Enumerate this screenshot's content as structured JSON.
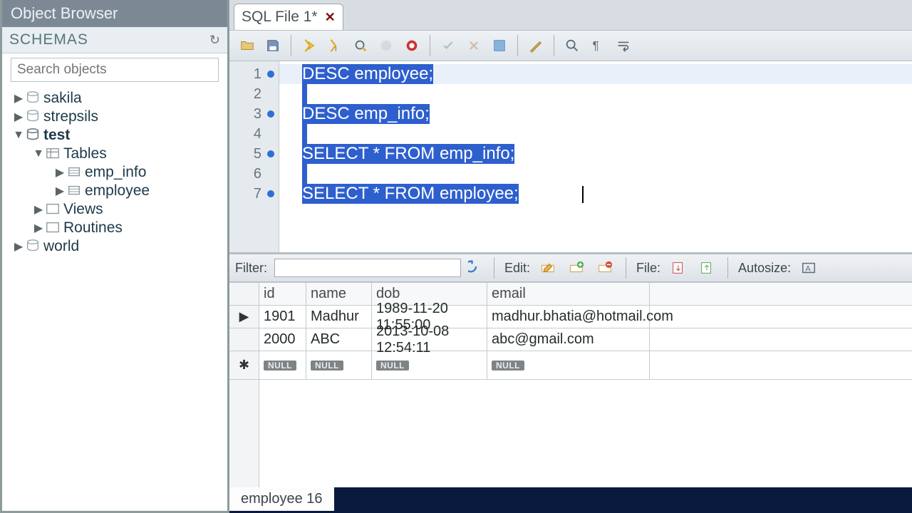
{
  "object_browser": {
    "title": "Object Browser",
    "schemas_label": "SCHEMAS",
    "search_placeholder": "Search objects",
    "tree": {
      "sakila": "sakila",
      "strepsils": "strepsils",
      "test": "test",
      "tables": "Tables",
      "emp_info": "emp_info",
      "employee": "employee",
      "views": "Views",
      "routines": "Routines",
      "world": "world"
    }
  },
  "tab": {
    "label": "SQL File 1*"
  },
  "editor": {
    "lines": {
      "1": {
        "kw": "DESC",
        "rest": " employee;"
      },
      "2": {
        "kw": "",
        "rest": ""
      },
      "3": {
        "kw": "DESC",
        "rest": " emp_info;"
      },
      "4": {
        "kw": "",
        "rest": ""
      },
      "5a": "SELECT",
      "5b": " * ",
      "5c": "FROM",
      "5d": " emp_info;",
      "6": {
        "kw": "",
        "rest": ""
      },
      "7a": "SELECT",
      "7b": " * ",
      "7c": "FROM",
      "7d": " employee;"
    },
    "numbers": [
      "1",
      "2",
      "3",
      "4",
      "5",
      "6",
      "7"
    ]
  },
  "filter": {
    "label": "Filter:",
    "edit": "Edit:",
    "file": "File:",
    "autosize": "Autosize:"
  },
  "grid": {
    "headers": {
      "id": "id",
      "name": "name",
      "dob": "dob",
      "email": "email"
    },
    "rows": [
      {
        "id": "1901",
        "name": "Madhur",
        "dob": "1989-11-20 11:55:00",
        "email": "madhur.bhatia@hotmail.com"
      },
      {
        "id": "2000",
        "name": "ABC",
        "dob": "2013-10-08 12:54:11",
        "email": "abc@gmail.com"
      }
    ],
    "null": "NULL"
  },
  "status": {
    "label": "employee 16"
  }
}
